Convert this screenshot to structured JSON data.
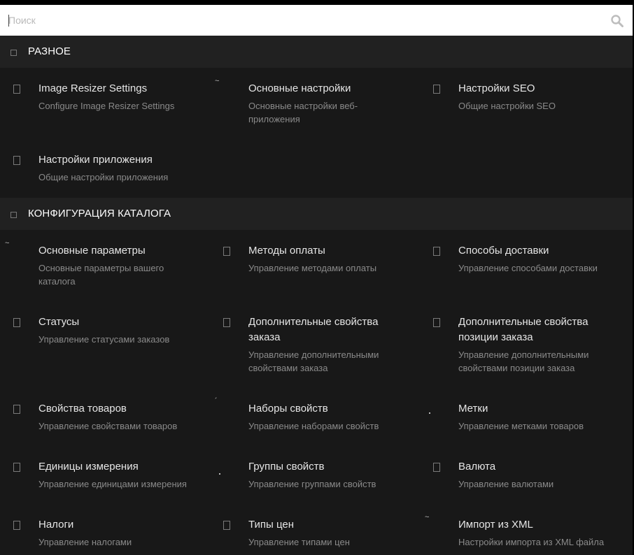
{
  "search": {
    "placeholder": "Поиск",
    "icon": "search-icon"
  },
  "sections": [
    {
      "title": "РАЗНОЕ",
      "items": [
        {
          "name": "Image Resizer Settings",
          "desc": "Configure Image Resizer Settings"
        },
        {
          "name": "Основные настройки",
          "desc": "Основные настройки веб-приложения"
        },
        {
          "name": "Настройки SEO",
          "desc": "Общие настройки SEO"
        },
        {
          "name": "Настройки приложения",
          "desc": "Общие настройки приложения"
        }
      ]
    },
    {
      "title": "КОНФИГУРАЦИЯ КАТАЛОГА",
      "items": [
        {
          "name": "Основные параметры",
          "desc": "Основные параметры вашего каталога"
        },
        {
          "name": "Методы оплаты",
          "desc": "Управление методами оплаты"
        },
        {
          "name": "Способы доставки",
          "desc": "Управление способами доставки"
        },
        {
          "name": "Статусы",
          "desc": "Управление статусами заказов"
        },
        {
          "name": "Дополнительные свойства заказа",
          "desc": "Управление дополнительными свойствами заказа"
        },
        {
          "name": "Дополнительные свойства позиции заказа",
          "desc": "Управление дополнительными свойствами позиции заказа"
        },
        {
          "name": "Свойства товаров",
          "desc": "Управление свойствами товаров"
        },
        {
          "name": "Наборы свойств",
          "desc": "Управление наборами свойств"
        },
        {
          "name": "Метки",
          "desc": "Управление метками товаров"
        },
        {
          "name": "Единицы измерения",
          "desc": "Управление единицами измерения"
        },
        {
          "name": "Группы свойств",
          "desc": "Управление группами свойств"
        },
        {
          "name": "Валюта",
          "desc": "Управление валютами"
        },
        {
          "name": "Налоги",
          "desc": "Управление налогами"
        },
        {
          "name": "Типы цен",
          "desc": "Управление типами цен"
        },
        {
          "name": "Импорт из XML",
          "desc": "Настройки импорта из XML файла"
        }
      ]
    }
  ]
}
